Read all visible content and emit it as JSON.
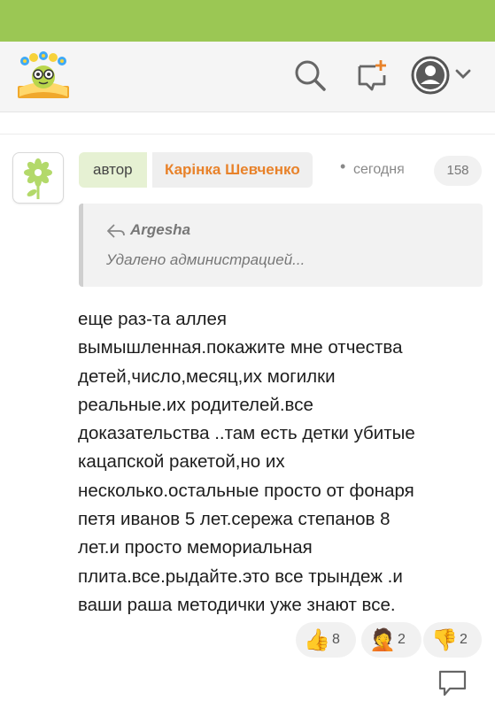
{
  "header": {
    "logo_icon": "kids-book-flowers-logo",
    "search_icon": "search-icon",
    "compose_icon": "new-message-icon",
    "account_icon": "user-avatar-icon",
    "account_chevron": "chevron-down-icon",
    "accent_color": "#9bc754"
  },
  "comment": {
    "author_prefix": "автор",
    "author_name": "Карінка Шевченко",
    "separator": "•",
    "time": "сегодня",
    "number": "158",
    "quote": {
      "author": "Argesha",
      "text": "Удалено администрацией..."
    },
    "body": "еще раз-та аллея\nвымышленная.покажите мне отчества\nдетей,число,месяц,их могилки\nреальные.их родителей.все\nдоказательства ..там есть детки убитые\nкацапской ракетой,но их\nнесколько.остальные просто от фонаря\nпетя иванов 5 лет.сережа степанов 8\nлет.и просто мемориальная\nплита.все.рыдайте.это все трындеж .и\nваши раша методички уже знают все.",
    "reactions": [
      {
        "emoji": "👍",
        "count": "8"
      },
      {
        "emoji": "🤦",
        "count": "2"
      },
      {
        "emoji": "👎",
        "count": "2"
      }
    ],
    "author_color": "#e8822a"
  }
}
